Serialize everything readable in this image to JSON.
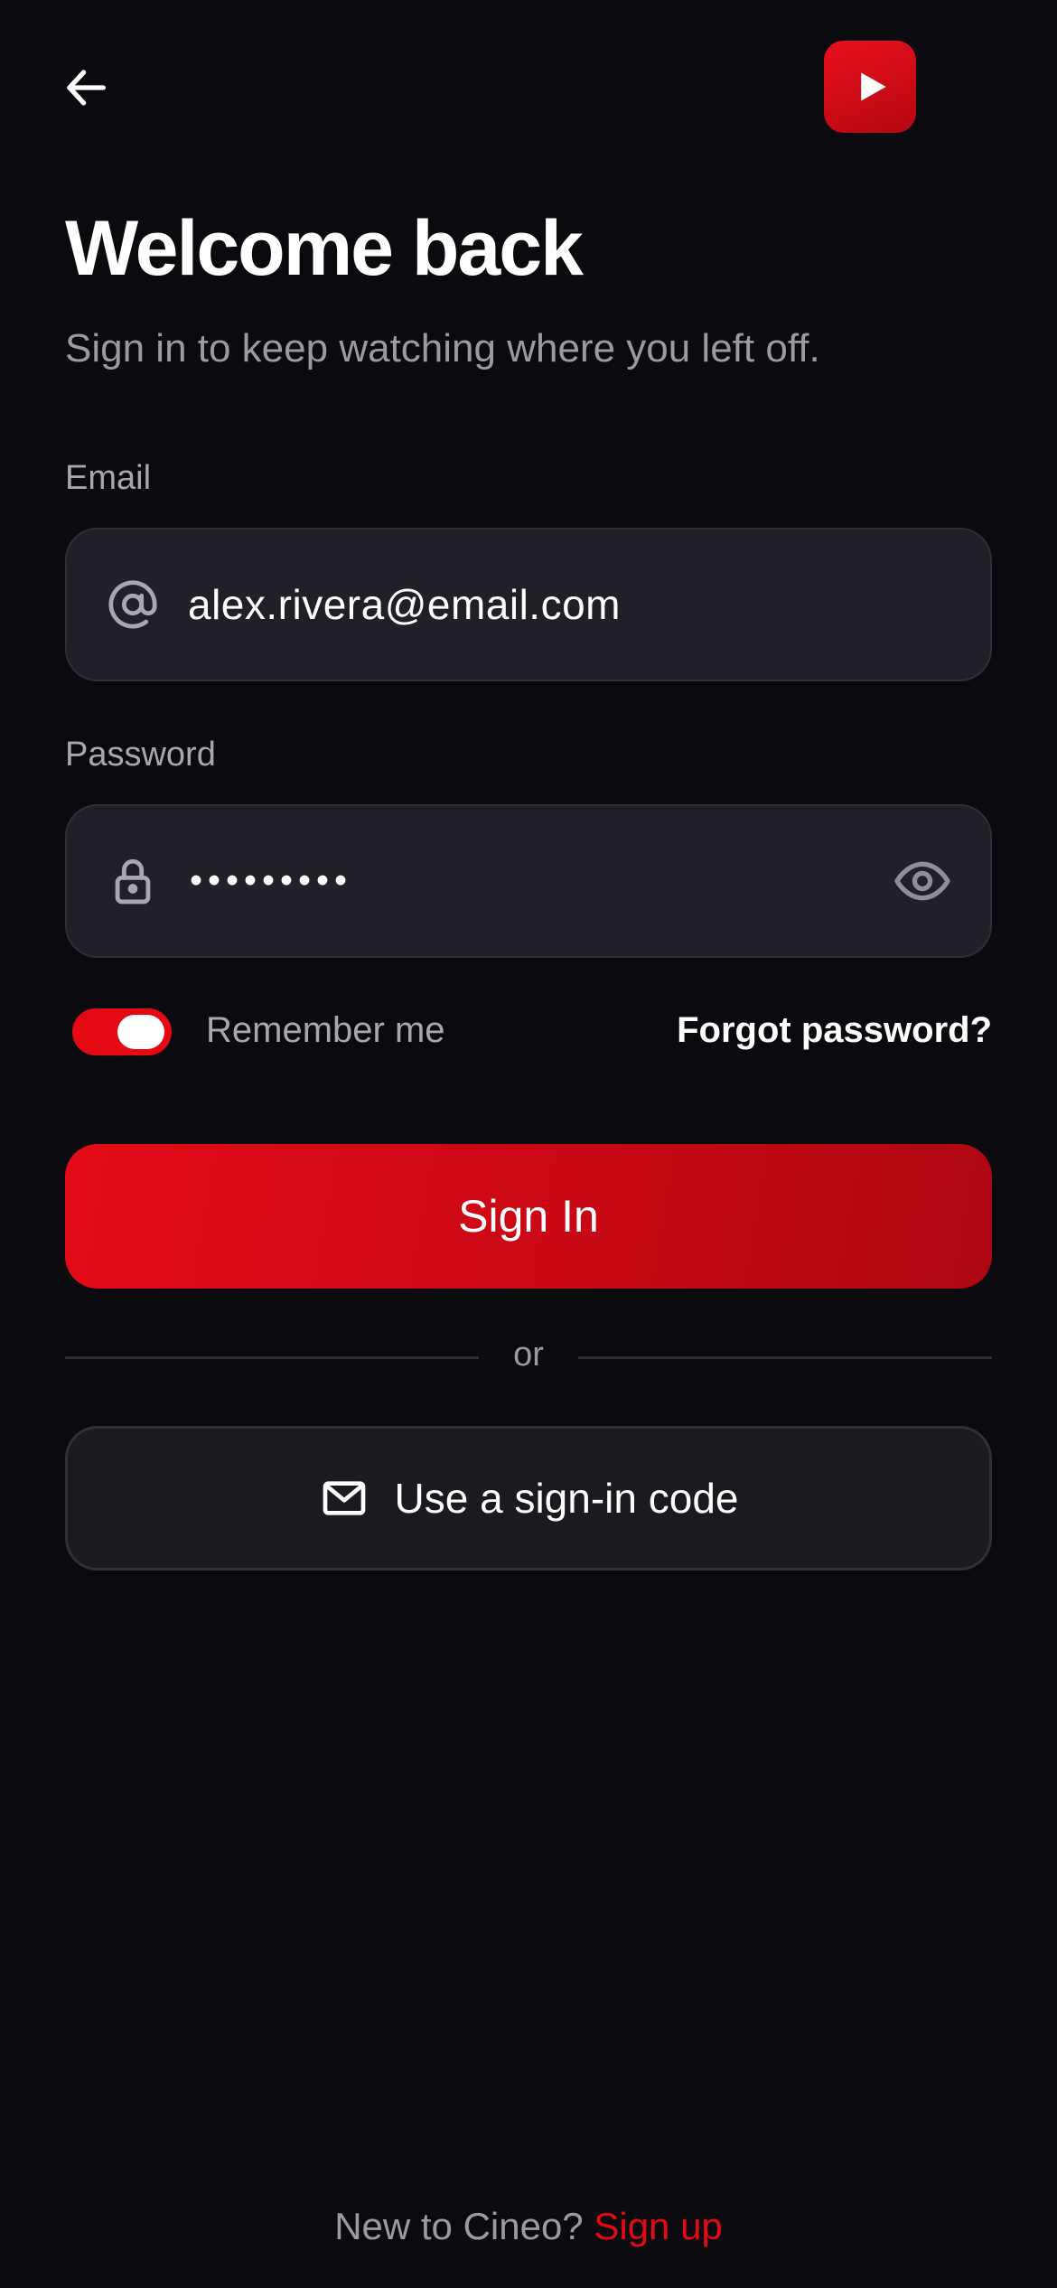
{
  "header": {
    "back_icon": "arrow-left-icon",
    "logo_icon": "play-icon"
  },
  "colors": {
    "background": "#0b0b0f",
    "accent": "#e50914",
    "input_bg": "#1f2028",
    "muted_text": "#9a9aa3"
  },
  "main": {
    "title": "Welcome back",
    "subtitle": "Sign in to keep watching where you left off."
  },
  "form": {
    "email": {
      "label": "Email",
      "value": "alex.rivera@email.com",
      "icon": "at-sign-icon"
    },
    "password": {
      "label": "Password",
      "masked_value": "•••••••••",
      "icon": "lock-icon",
      "toggle_icon": "eye-icon"
    },
    "remember": {
      "label": "Remember me",
      "checked": true
    },
    "forgot_label": "Forgot password?",
    "submit_label": "Sign In",
    "divider_text": "or",
    "code_button": {
      "label": "Use a sign-in code",
      "icon": "mail-icon"
    }
  },
  "footer": {
    "prompt": "New to Cineo?",
    "signup_label": "Sign up"
  }
}
